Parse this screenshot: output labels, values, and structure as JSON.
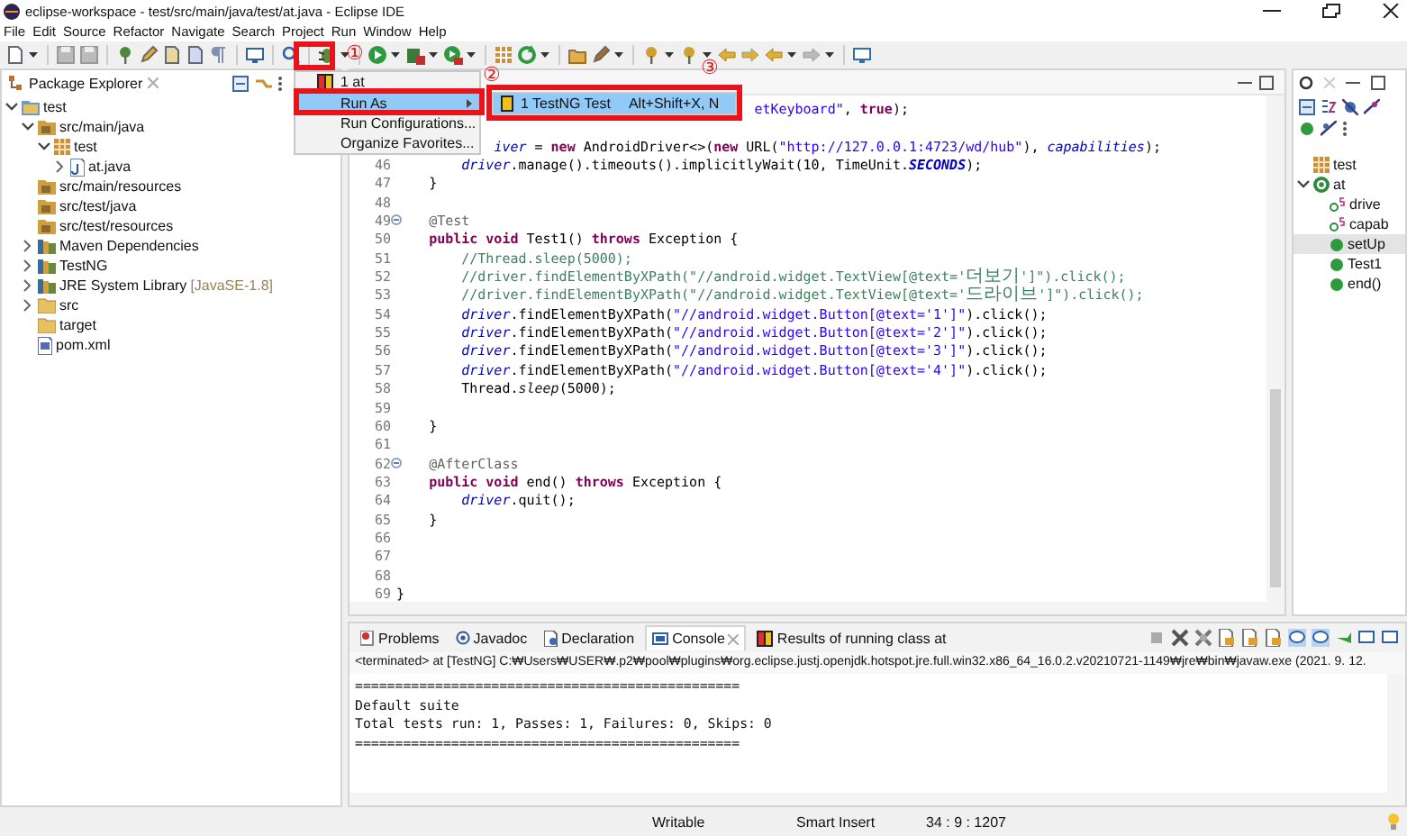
{
  "window": {
    "title": "eclipse-workspace - test/src/main/java/test/at.java - Eclipse IDE"
  },
  "menu_bar": [
    "File",
    "Edit",
    "Source",
    "Refactor",
    "Navigate",
    "Search",
    "Project",
    "Run",
    "Window",
    "Help"
  ],
  "run_menu": {
    "items": [
      {
        "label": "1 at",
        "kind": "history",
        "selected": false
      },
      {
        "label": "Run As",
        "kind": "submenu",
        "selected": true
      },
      {
        "label": "Run Configurations...",
        "kind": "plain",
        "selected": false
      },
      {
        "label": "Organize Favorites...",
        "kind": "plain",
        "selected": false
      }
    ],
    "submenu": {
      "label": "1 TestNG Test",
      "shortcut": "Alt+Shift+X, N",
      "selected": true
    }
  },
  "annotations": [
    "①",
    "②",
    "③"
  ],
  "package_explorer": {
    "title": "Package Explorer",
    "tree": [
      {
        "label": "test",
        "kind": "project",
        "expanded": true,
        "children": [
          {
            "label": "src/main/java",
            "kind": "source-folder",
            "expanded": true,
            "children": [
              {
                "label": "test",
                "kind": "package",
                "expanded": true,
                "children": [
                  {
                    "label": "at.java",
                    "kind": "java-file",
                    "expanded": false
                  }
                ]
              }
            ]
          },
          {
            "label": "src/main/resources",
            "kind": "source-folder"
          },
          {
            "label": "src/test/java",
            "kind": "source-folder"
          },
          {
            "label": "src/test/resources",
            "kind": "source-folder"
          },
          {
            "label": "Maven Dependencies",
            "kind": "library",
            "expanded": false
          },
          {
            "label": "TestNG",
            "kind": "library",
            "expanded": false
          },
          {
            "label": "JRE System Library",
            "suffix": "[JavaSE-1.8]",
            "kind": "library",
            "expanded": false
          },
          {
            "label": "src",
            "kind": "folder",
            "expanded": false
          },
          {
            "label": "target",
            "kind": "folder"
          },
          {
            "label": "pom.xml",
            "kind": "xml-file"
          }
        ]
      }
    ]
  },
  "editor": {
    "lines": [
      {
        "kind": "code",
        "tokens": [
          {
            "text": "                                            etKeyboard\"",
            "kind": "string"
          },
          {
            "text": ", ",
            "kind": "plain"
          },
          {
            "text": "true",
            "kind": "keyword"
          },
          {
            "text": ");",
            "kind": "plain"
          }
        ]
      },
      {
        "kind": "blank"
      },
      {
        "kind": "code",
        "tokens": [
          {
            "text": "            iver",
            "kind": "field"
          },
          {
            "text": " = ",
            "kind": "plain"
          },
          {
            "text": "new",
            "kind": "keyword"
          },
          {
            "text": " AndroidDriver<>(",
            "kind": "plain"
          },
          {
            "text": "new",
            "kind": "keyword"
          },
          {
            "text": " URL(",
            "kind": "plain"
          },
          {
            "text": "\"http://127.0.0.1:4723/wd/hub\"",
            "kind": "string"
          },
          {
            "text": "), ",
            "kind": "plain"
          },
          {
            "text": "capabilities",
            "kind": "field"
          },
          {
            "text": ");",
            "kind": "plain"
          }
        ]
      },
      {
        "kind": "code",
        "number": "46",
        "collapsible": false,
        "tokens": [
          {
            "text": "        driver",
            "kind": "field"
          },
          {
            "text": ".manage().timeouts().implicitlyWait(10, TimeUnit.",
            "kind": "plain"
          },
          {
            "text": "SECONDS",
            "kind": "static-field"
          },
          {
            "text": ");",
            "kind": "plain"
          }
        ]
      },
      {
        "kind": "code",
        "number": "47",
        "collapsible": false,
        "tokens": [
          {
            "text": "    }",
            "kind": "plain"
          }
        ]
      },
      {
        "kind": "blank",
        "number": "48",
        "collapsible": false
      },
      {
        "kind": "code",
        "number": "49",
        "collapsible": true,
        "tokens": [
          {
            "text": "    @Test",
            "kind": "annotation"
          }
        ]
      },
      {
        "kind": "code",
        "number": "50",
        "collapsible": false,
        "tokens": [
          {
            "text": "    public void",
            "kind": "keyword"
          },
          {
            "text": " Test1() ",
            "kind": "plain"
          },
          {
            "text": "throws",
            "kind": "keyword"
          },
          {
            "text": " Exception {",
            "kind": "plain"
          }
        ]
      },
      {
        "kind": "code",
        "number": "51",
        "collapsible": false,
        "tokens": [
          {
            "text": "        //Thread.sleep(5000);",
            "kind": "comment"
          }
        ]
      },
      {
        "kind": "code",
        "number": "52",
        "collapsible": false,
        "tokens": [
          {
            "text": "        //driver.findElementByXPath(\"//android.widget.TextView[@text='",
            "kind": "comment"
          },
          {
            "text": "더보기",
            "kind": "comment-cjk"
          },
          {
            "text": "']\").click();",
            "kind": "comment"
          }
        ]
      },
      {
        "kind": "code",
        "number": "53",
        "collapsible": false,
        "tokens": [
          {
            "text": "        //driver.findElementByXPath(\"//android.widget.TextView[@text='",
            "kind": "comment"
          },
          {
            "text": "드라이브",
            "kind": "comment-cjk"
          },
          {
            "text": "']\").click();",
            "kind": "comment"
          }
        ]
      },
      {
        "kind": "code",
        "number": "54",
        "collapsible": false,
        "tokens": [
          {
            "text": "        driver",
            "kind": "field"
          },
          {
            "text": ".findElementByXPath(",
            "kind": "plain"
          },
          {
            "text": "\"//android.widget.Button[@text='1']\"",
            "kind": "string"
          },
          {
            "text": ").click();",
            "kind": "plain"
          }
        ]
      },
      {
        "kind": "code",
        "number": "55",
        "collapsible": false,
        "tokens": [
          {
            "text": "        driver",
            "kind": "field"
          },
          {
            "text": ".findElementByXPath(",
            "kind": "plain"
          },
          {
            "text": "\"//android.widget.Button[@text='2']\"",
            "kind": "string"
          },
          {
            "text": ").click();",
            "kind": "plain"
          }
        ]
      },
      {
        "kind": "code",
        "number": "56",
        "collapsible": false,
        "tokens": [
          {
            "text": "        driver",
            "kind": "field"
          },
          {
            "text": ".findElementByXPath(",
            "kind": "plain"
          },
          {
            "text": "\"//android.widget.Button[@text='3']\"",
            "kind": "string"
          },
          {
            "text": ").click();",
            "kind": "plain"
          }
        ]
      },
      {
        "kind": "code",
        "number": "57",
        "collapsible": false,
        "tokens": [
          {
            "text": "        driver",
            "kind": "field"
          },
          {
            "text": ".findElementByXPath(",
            "kind": "plain"
          },
          {
            "text": "\"//android.widget.Button[@text='4']\"",
            "kind": "string"
          },
          {
            "text": ").click();",
            "kind": "plain"
          }
        ]
      },
      {
        "kind": "code",
        "number": "58",
        "collapsible": false,
        "tokens": [
          {
            "text": "        Thread.",
            "kind": "plain"
          },
          {
            "text": "sleep",
            "kind": "static"
          },
          {
            "text": "(5000);",
            "kind": "plain"
          }
        ]
      },
      {
        "kind": "blank",
        "number": "59",
        "collapsible": false
      },
      {
        "kind": "code",
        "number": "60",
        "collapsible": false,
        "tokens": [
          {
            "text": "    }",
            "kind": "plain"
          }
        ]
      },
      {
        "kind": "blank",
        "number": "61",
        "collapsible": false
      },
      {
        "kind": "code",
        "number": "62",
        "collapsible": true,
        "tokens": [
          {
            "text": "    @AfterClass",
            "kind": "annotation"
          }
        ]
      },
      {
        "kind": "code",
        "number": "63",
        "collapsible": false,
        "tokens": [
          {
            "text": "    public void",
            "kind": "keyword"
          },
          {
            "text": " end() ",
            "kind": "plain"
          },
          {
            "text": "throws",
            "kind": "keyword"
          },
          {
            "text": " Exception {",
            "kind": "plain"
          }
        ]
      },
      {
        "kind": "code",
        "number": "64",
        "collapsible": false,
        "tokens": [
          {
            "text": "        driver",
            "kind": "field"
          },
          {
            "text": ".quit();",
            "kind": "plain"
          }
        ]
      },
      {
        "kind": "code",
        "number": "65",
        "collapsible": false,
        "tokens": [
          {
            "text": "    }",
            "kind": "plain"
          }
        ]
      },
      {
        "kind": "blank",
        "number": "66",
        "collapsible": false
      },
      {
        "kind": "blank",
        "number": "67",
        "collapsible": false
      },
      {
        "kind": "blank",
        "number": "68",
        "collapsible": false
      },
      {
        "kind": "code",
        "number": "69",
        "collapsible": false,
        "tokens": [
          {
            "text": "}",
            "kind": "plain"
          }
        ]
      }
    ]
  },
  "outline": {
    "tree": [
      {
        "label": "test",
        "kind": "package",
        "selected": false
      },
      {
        "label": "at",
        "kind": "class",
        "selected": false,
        "expanded": true,
        "children": [
          {
            "label": "drive",
            "kind": "static-field",
            "selected": false
          },
          {
            "label": "capab",
            "kind": "static-field",
            "selected": false
          },
          {
            "label": "setUp",
            "kind": "method",
            "selected": true
          },
          {
            "label": "Test1",
            "kind": "method",
            "selected": false
          },
          {
            "label": "end()",
            "kind": "method",
            "selected": false
          }
        ]
      }
    ]
  },
  "console": {
    "tabs": [
      {
        "label": "Problems",
        "kind": "problems",
        "selected": false
      },
      {
        "label": "Javadoc",
        "kind": "javadoc",
        "selected": false
      },
      {
        "label": "Declaration",
        "kind": "declaration",
        "selected": false
      },
      {
        "label": "Console",
        "kind": "console",
        "selected": true
      },
      {
        "label": "Results of running class at",
        "kind": "testng",
        "selected": false
      }
    ],
    "process": "<terminated> at [TestNG] C:₩Users₩USER₩.p2₩pool₩plugins₩org.eclipse.justj.openjdk.hotspot.jre.full.win32.x86_64_16.0.2.v20210721-1149₩jre₩bin₩javaw.exe  (2021. 9. 12.",
    "output": [
      "================================================",
      "Default suite",
      "Total tests run: 1, Passes: 1, Failures: 0, Skips: 0",
      "================================================"
    ]
  },
  "status_bar": {
    "mode": "Writable",
    "insert": "Smart Insert",
    "position": "34 : 9 : 1207"
  }
}
